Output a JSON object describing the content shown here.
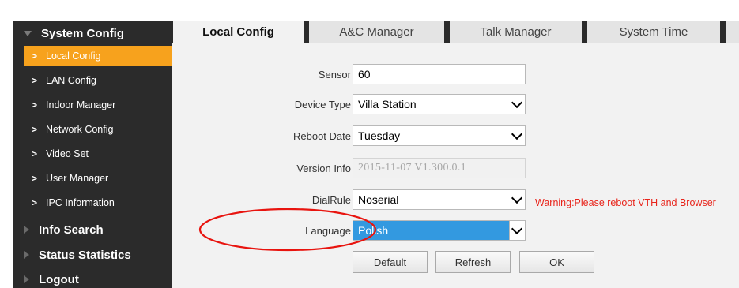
{
  "sidebar": {
    "groups": [
      {
        "label": "System Config",
        "expanded": true
      },
      {
        "label": "Info Search"
      },
      {
        "label": "Status Statistics"
      },
      {
        "label": "Logout"
      }
    ],
    "items": [
      {
        "label": "Local Config",
        "active": true
      },
      {
        "label": "LAN Config"
      },
      {
        "label": "Indoor Manager"
      },
      {
        "label": "Network Config"
      },
      {
        "label": "Video Set"
      },
      {
        "label": "User Manager"
      },
      {
        "label": "IPC Information"
      }
    ]
  },
  "tabs": [
    {
      "label": "Local Config",
      "active": true
    },
    {
      "label": "A&C Manager"
    },
    {
      "label": "Talk Manager"
    },
    {
      "label": "System Time"
    }
  ],
  "form": {
    "sensor": {
      "label": "Sensor",
      "value": "60"
    },
    "device_type": {
      "label": "Device Type",
      "value": "Villa Station"
    },
    "reboot_date": {
      "label": "Reboot Date",
      "value": "Tuesday"
    },
    "version_info": {
      "label": "Version Info",
      "value": "2015-11-07 V1.300.0.1"
    },
    "dial_rule": {
      "label": "DialRule",
      "value": "Noserial"
    },
    "language": {
      "label": "Language",
      "value": "Polish"
    },
    "warning": "Warning:Please reboot VTH and Browser"
  },
  "buttons": {
    "default": "Default",
    "refresh": "Refresh",
    "ok": "OK"
  },
  "colors": {
    "sidebar_bg": "#2b2b2b",
    "active_item": "#f7a21d",
    "content_bg": "#f2f2f2",
    "warning": "#e8241b",
    "selected_option": "#3399e0",
    "annotation": "#e8140f"
  }
}
